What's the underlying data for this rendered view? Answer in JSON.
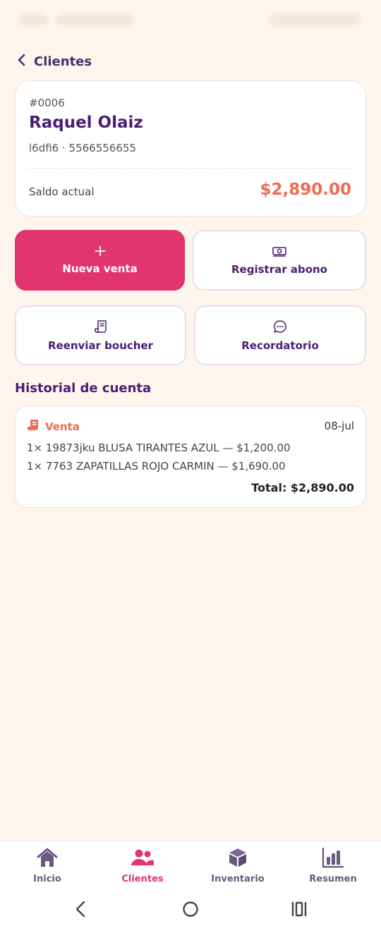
{
  "nav": {
    "back_label": "Clientes"
  },
  "client": {
    "id": "#0006",
    "name": "Raquel Olaiz",
    "meta": "l6dfi6 · 5566556655",
    "balance_label": "Saldo actual",
    "balance_value": "$2,890.00"
  },
  "actions": {
    "new_sale": "Nueva venta",
    "register_payment": "Registrar abono",
    "resend_voucher": "Reenviar boucher",
    "reminder": "Recordatorio"
  },
  "history": {
    "title": "Historial de cuenta",
    "entries": [
      {
        "type": "Venta",
        "date": "08-jul",
        "lines": [
          "1× 19873jku BLUSA TIRANTES AZUL — $1,200.00",
          "1× 7763 ZAPATILLAS ROJO CARMIN — $1,690.00"
        ],
        "total": "Total: $2,890.00"
      }
    ]
  },
  "bottom_nav": {
    "items": [
      {
        "label": "Inicio",
        "icon": "home-icon"
      },
      {
        "label": "Clientes",
        "icon": "users-icon",
        "active": true
      },
      {
        "label": "Inventario",
        "icon": "box-icon"
      },
      {
        "label": "Resumen",
        "icon": "bar-chart-icon"
      }
    ]
  },
  "colors": {
    "background": "#fef5ed",
    "primary": "#e2346e",
    "accent_title": "#4b1d73",
    "balance": "#f06b52"
  }
}
